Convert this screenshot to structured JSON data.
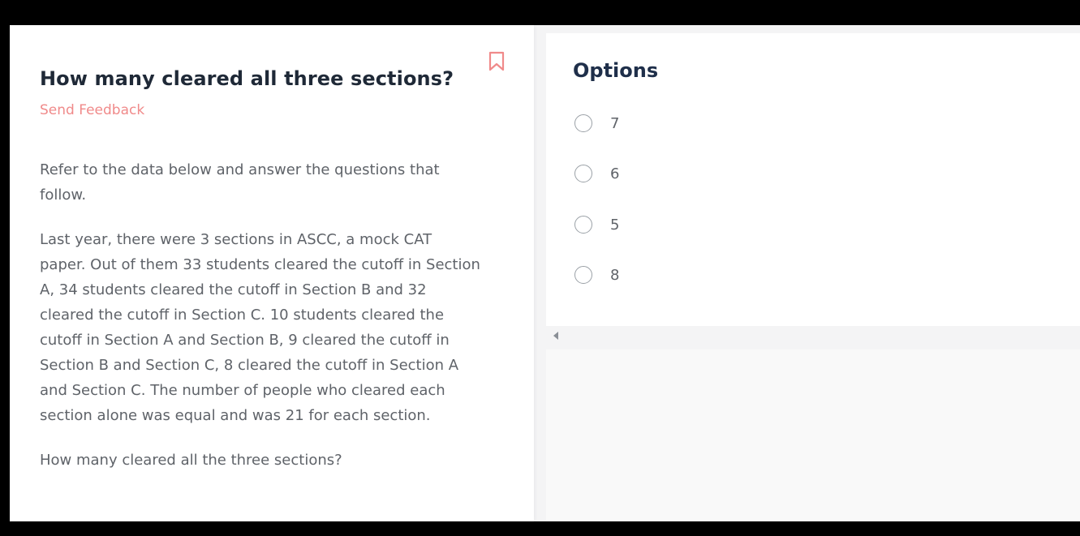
{
  "question": {
    "title": "How many cleared all three sections?",
    "feedback_label": "Send Feedback",
    "bookmark_icon": "bookmark-icon",
    "passage": [
      "Refer to the data below and answer the questions that follow.",
      "Last year, there were 3 sections in ASCC, a mock CAT paper. Out of them 33 students cleared the cutoff in Section A, 34 students cleared the cutoff in Section B and 32 cleared the cutoff in Section C. 10 students cleared the cutoff in Section A and Section B, 9 cleared the cutoff in Section B and Section C, 8 cleared the cutoff in Section A and Section C. The number of people who cleared each section alone was equal and was 21 for each section.",
      "How many cleared all the three sections?"
    ]
  },
  "options": {
    "title": "Options",
    "items": [
      {
        "label": "7"
      },
      {
        "label": "6"
      },
      {
        "label": "5"
      },
      {
        "label": "8"
      }
    ]
  },
  "colors": {
    "accent": "#f08a8a",
    "heading": "#1f2937",
    "body_text": "#5f6369"
  }
}
